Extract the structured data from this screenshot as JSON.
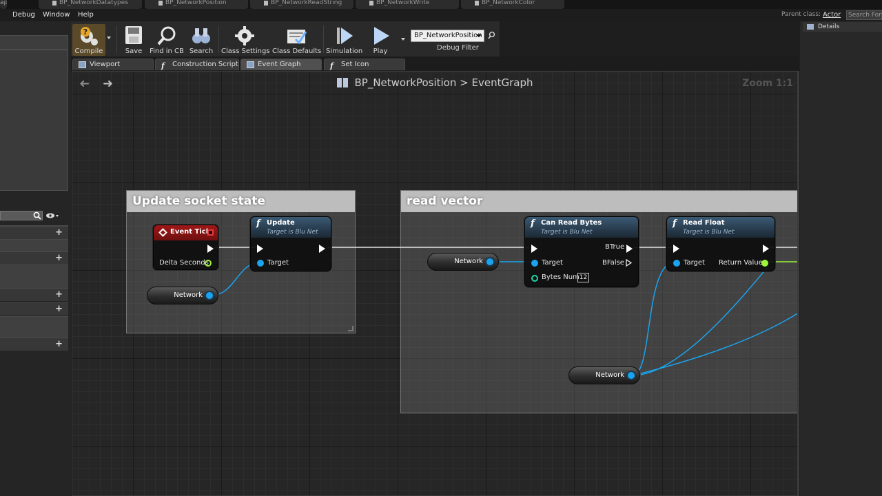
{
  "file_tabs": [
    "BP_NetworkDatatypes",
    "BP_NetworkPosition",
    "BP_NetworkReadString",
    "BP_NetworkWrite",
    "BP_NetworkColor"
  ],
  "menu": {
    "partial": "ap",
    "items": [
      "Debug",
      "Window",
      "Help"
    ]
  },
  "parent_class": {
    "label": "Parent class:",
    "value": "Actor"
  },
  "search_placeholder": "Search For",
  "toolbar": {
    "compile": "Compile",
    "save": "Save",
    "find_in_cb": "Find in CB",
    "search": "Search",
    "class_settings": "Class Settings",
    "class_defaults": "Class Defaults",
    "simulation": "Simulation",
    "play": "Play",
    "debug_object": "BP_NetworkPosition",
    "debug_filter": "Debug Filter"
  },
  "editor_tabs": [
    "Viewport",
    "Construction Script",
    "Event Graph",
    "Set Icon"
  ],
  "details_title": "Details",
  "graph": {
    "breadcrumb_bp": "BP_NetworkPosition",
    "breadcrumb_sep": ">",
    "breadcrumb_graph": "EventGraph",
    "zoom": "Zoom 1:1",
    "comments": {
      "update": "Update socket state",
      "read": "read vector"
    },
    "event_tick": {
      "title": "Event Tick",
      "delta": "Delta Seconds"
    },
    "update_node": {
      "title": "Update",
      "subtitle": "Target is Blu Net",
      "target": "Target"
    },
    "can_read": {
      "title": "Can Read Bytes",
      "subtitle": "Target is Blu Net",
      "target": "Target",
      "btrue": "BTrue",
      "bfalse": "BFalse",
      "bytes_num": "Bytes Num",
      "bytes_value": "12"
    },
    "read_float": {
      "title": "Read Float",
      "subtitle": "Target is Blu Net",
      "target": "Target",
      "return": "Return Value"
    },
    "network_var": "Network"
  },
  "colors": {
    "exec": "#ffffff",
    "object_pin": "#1aa4f0",
    "float_pin": "#9cf53a",
    "event_header": "#a01818",
    "function_header": "#3b5a74"
  }
}
